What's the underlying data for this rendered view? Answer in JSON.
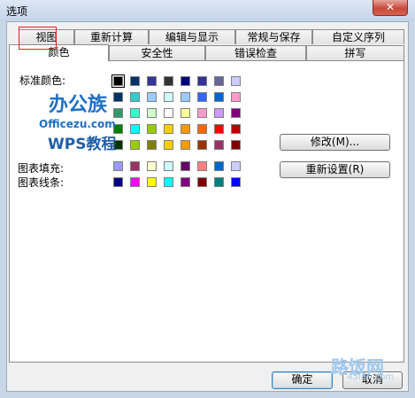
{
  "window": {
    "title": "选项",
    "close_glyph": "✕"
  },
  "tabs_row1": [
    {
      "label": "视图"
    },
    {
      "label": "重新计算"
    },
    {
      "label": "编辑与显示"
    },
    {
      "label": "常规与保存"
    },
    {
      "label": "自定义序列"
    }
  ],
  "tabs_row2": [
    {
      "label": "颜色",
      "active": true
    },
    {
      "label": "安全性"
    },
    {
      "label": "错误检查"
    },
    {
      "label": "拼写"
    }
  ],
  "color_panel": {
    "standard_label": "标准颜色:",
    "chart_fill_label": "图表填充:",
    "chart_line_label": "图表线条:",
    "modify_button": "修改(M)...",
    "reset_button": "重新设置(R)",
    "standard_colors": [
      [
        "#000000",
        "#003366",
        "#333399",
        "#333333",
        "#000080",
        "#333399",
        "#666699",
        "#ccccff"
      ],
      [
        "#003366",
        "#33cccc",
        "#99ccff",
        "#ccffff",
        "#99ccff",
        "#3366ff",
        "#0066cc",
        "#ff99cc"
      ],
      [
        "#339966",
        "#33ffcc",
        "#ccffcc",
        "#ffffff",
        "#ffff99",
        "#ff99cc",
        "#cc99ff",
        "#800080"
      ],
      [
        "#008000",
        "#00ffff",
        "#99cc00",
        "#ffcc00",
        "#ff9900",
        "#ff6600",
        "#ff0000",
        "#c00000"
      ],
      [
        "#003300",
        "#99cc00",
        "#808000",
        "#ffcc00",
        "#ff9900",
        "#993300",
        "#993366",
        "#800000"
      ]
    ],
    "chart_fill_colors": [
      "#9999ff",
      "#993366",
      "#ffffcc",
      "#ccffff",
      "#660066",
      "#ff8080",
      "#0066cc",
      "#ccccff"
    ],
    "chart_line_colors": [
      "#000080",
      "#ff00ff",
      "#ffff00",
      "#00ffff",
      "#800080",
      "#800000",
      "#008080",
      "#0000ff"
    ]
  },
  "footer": {
    "ok_button": "确定",
    "cancel_button": "取消"
  },
  "watermarks": {
    "logo_text": "办公族",
    "site_text": "Officezu.com",
    "wps_text": "WPS教程",
    "corner_text": "路饭网",
    "corner_url": "45fan.com"
  }
}
